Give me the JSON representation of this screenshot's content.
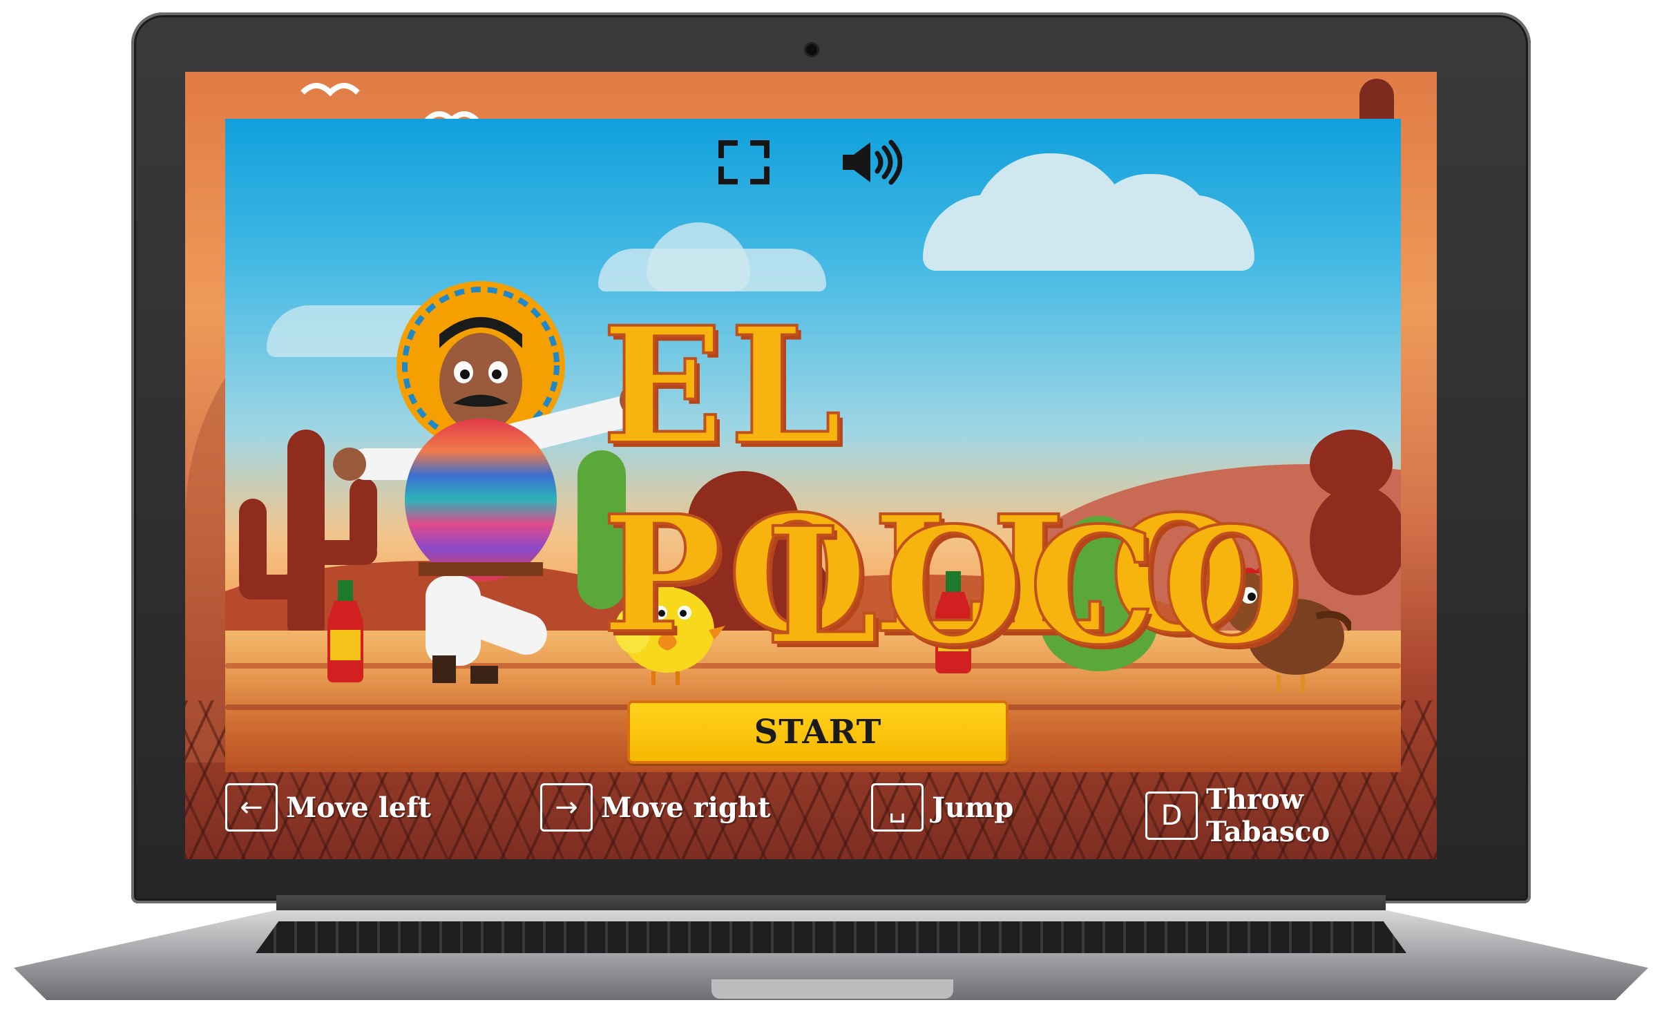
{
  "game": {
    "title_line1": "EL POLLO",
    "title_line2": "LOCO",
    "start_label": "START"
  },
  "hud": {
    "fullscreen_icon": "fullscreen-icon",
    "sound_icon": "speaker-on-icon"
  },
  "controls": [
    {
      "key": "←",
      "label": "Move left"
    },
    {
      "key": "→",
      "label": "Move right"
    },
    {
      "key": "␣",
      "label": "Jump"
    },
    {
      "key": "D",
      "label": "Throw Tabasco"
    }
  ],
  "colors": {
    "title_fill": "#f7b40e",
    "title_outline": "#c0501c",
    "start_button": "#ffd21c",
    "start_border": "#d8700e",
    "legend_text": "#ffffff"
  }
}
